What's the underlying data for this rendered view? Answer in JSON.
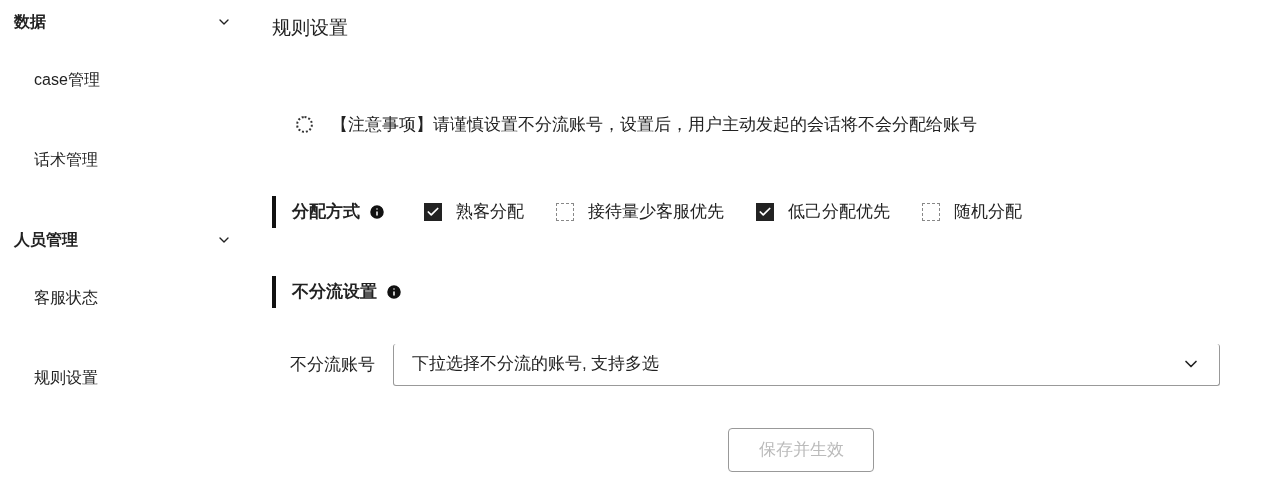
{
  "sidebar": {
    "groups": [
      {
        "label": "数据",
        "expanded": true,
        "items": [
          {
            "label": "case管理",
            "selected": false
          },
          {
            "label": "话术管理",
            "selected": false
          }
        ]
      },
      {
        "label": "人员管理",
        "expanded": true,
        "items": [
          {
            "label": "客服状态",
            "selected": false
          },
          {
            "label": "规则设置",
            "selected": false
          }
        ]
      }
    ]
  },
  "page_title": "规则设置",
  "notice": "【注意事项】请谨慎设置不分流账号，设置后，用户主动发起的会话将不会分配给账号",
  "distribution": {
    "title": "分配方式",
    "options": [
      {
        "label": "熟客分配",
        "checked": true
      },
      {
        "label": "接待量少客服优先",
        "checked": false
      },
      {
        "label": "低己分配优先",
        "checked": true
      },
      {
        "label": "随机分配",
        "checked": false
      }
    ]
  },
  "no_split": {
    "title": "不分流设置",
    "field_label": "不分流账号",
    "placeholder": "下拉选择不分流的账号, 支持多选"
  },
  "save_button": {
    "label": "保存并生效",
    "disabled": true
  }
}
